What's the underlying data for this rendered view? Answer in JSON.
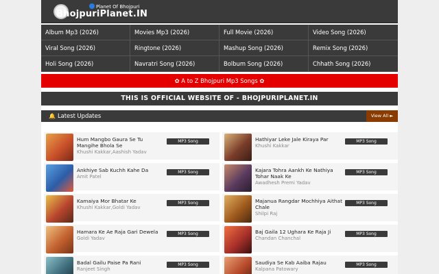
{
  "header": {
    "logo_tagline": "Planet Of Bhojpuri",
    "logo_name": "BhojpuriPlanet.IN"
  },
  "nav": [
    "Album Mp3 (2026)",
    "Movies Mp3 (2026)",
    "Full Movie (2026)",
    "Video Song (2026)",
    "Viral Song (2026)",
    "Ringtone (2026)",
    "Mashup Song (2026)",
    "Remix Song (2026)",
    "Holi Song (2026)",
    "Navratri Song (2026)",
    "Bolbum Song (2026)",
    "Chhath Song (2026)"
  ],
  "az_link": "✿ A to Z Bhojpuri Mp3 Songs ✿",
  "banner": "THIS IS OFFICIAL WEBSITE OF - BHOJPURIPLANET.IN",
  "updates": {
    "title": "Latest Updates",
    "view_all": "View All ►"
  },
  "songs": [
    {
      "title": "Hum Mangbo Gaura Se Tu Mangihe Bhola Se",
      "artist": "Khushi Kakkar,Aashish Yadav",
      "type": "MP3 Song",
      "color": "#c9502a"
    },
    {
      "title": "Hathiyar Leke Jale Kiraya Par",
      "artist": "Khushi Kakkar",
      "type": "MP3 Song",
      "color": "#7a3d2a"
    },
    {
      "title": "Ankhiye Sab Kuchh Kahe Da",
      "artist": "Amit Patel",
      "type": "MP3 Song",
      "color": "#2c5da8"
    },
    {
      "title": "Kajara Tohra Aankh Ke Nathiya Tohar Naak Ke",
      "artist": "Awadhesh Premi Yadav",
      "type": "MP3 Song",
      "color": "#5a3a5f"
    },
    {
      "title": "Kamaiya Mor Bhatar Ke",
      "artist": "Khushi Kakkar,Goldi Yadav",
      "type": "MP3 Song",
      "color": "#b8452e"
    },
    {
      "title": "Majanua Rangdar Mochhiya Aithat Chale",
      "artist": "Shilpi Raj",
      "type": "MP3 Song",
      "color": "#a05a1e"
    },
    {
      "title": "Hamara Ke Ae Raja Gari Dewela",
      "artist": "Goldi Yadav",
      "type": "MP3 Song",
      "color": "#c2612f"
    },
    {
      "title": "Baj Gaila 12 Ughara Ke Raja Ji",
      "artist": "Chandan Chanchal",
      "type": "MP3 Song",
      "color": "#a8302a"
    },
    {
      "title": "Badal Gailu Paise Pa Rani",
      "artist": "Ranjeet Singh",
      "type": "MP3 Song",
      "color": "#3e6b7a"
    },
    {
      "title": "Saudiya Se Kab Aaiba Rajau",
      "artist": "Kalpana Patowary",
      "type": "MP3 Song",
      "color": "#b5482a"
    }
  ]
}
